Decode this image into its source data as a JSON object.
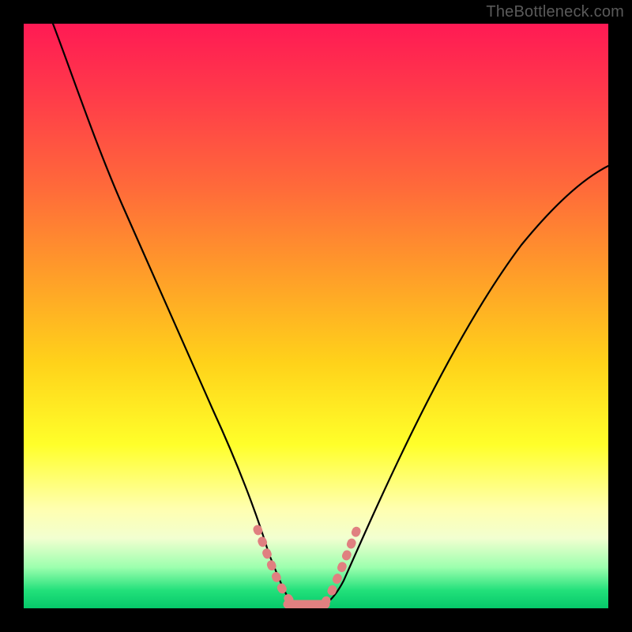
{
  "watermark": "TheBottleneck.com",
  "chart_data": {
    "type": "line",
    "title": "",
    "xlabel": "",
    "ylabel": "",
    "xlim": [
      0,
      100
    ],
    "ylim": [
      0,
      100
    ],
    "background_gradient": {
      "stops": [
        {
          "pos": 0,
          "color": "#ff1a54"
        },
        {
          "pos": 12,
          "color": "#ff3a4a"
        },
        {
          "pos": 28,
          "color": "#ff6a3a"
        },
        {
          "pos": 42,
          "color": "#ff9a2a"
        },
        {
          "pos": 58,
          "color": "#ffd21a"
        },
        {
          "pos": 72,
          "color": "#ffff2a"
        },
        {
          "pos": 83,
          "color": "#ffffb0"
        },
        {
          "pos": 88,
          "color": "#f2ffd0"
        },
        {
          "pos": 93,
          "color": "#9cffae"
        },
        {
          "pos": 97,
          "color": "#21e07a"
        },
        {
          "pos": 100,
          "color": "#06c86a"
        }
      ]
    },
    "series": [
      {
        "name": "bottleneck-curve",
        "color": "#000000",
        "x": [
          5,
          10,
          15,
          20,
          25,
          30,
          35,
          38,
          40,
          42,
          45,
          48,
          50,
          55,
          60,
          65,
          70,
          75,
          80,
          85,
          90,
          95,
          100
        ],
        "y": [
          100,
          84,
          70,
          57,
          45,
          34,
          22,
          14,
          8,
          3,
          0,
          0,
          0,
          5,
          12,
          20,
          28,
          36,
          44,
          51,
          58,
          65,
          71
        ]
      }
    ],
    "highlight": {
      "name": "optimal-range",
      "color": "#e57373",
      "x": [
        38,
        40,
        42,
        44,
        46,
        48,
        50,
        52,
        54
      ],
      "y": [
        14,
        8,
        3,
        0,
        0,
        0,
        0,
        3,
        7
      ]
    }
  }
}
